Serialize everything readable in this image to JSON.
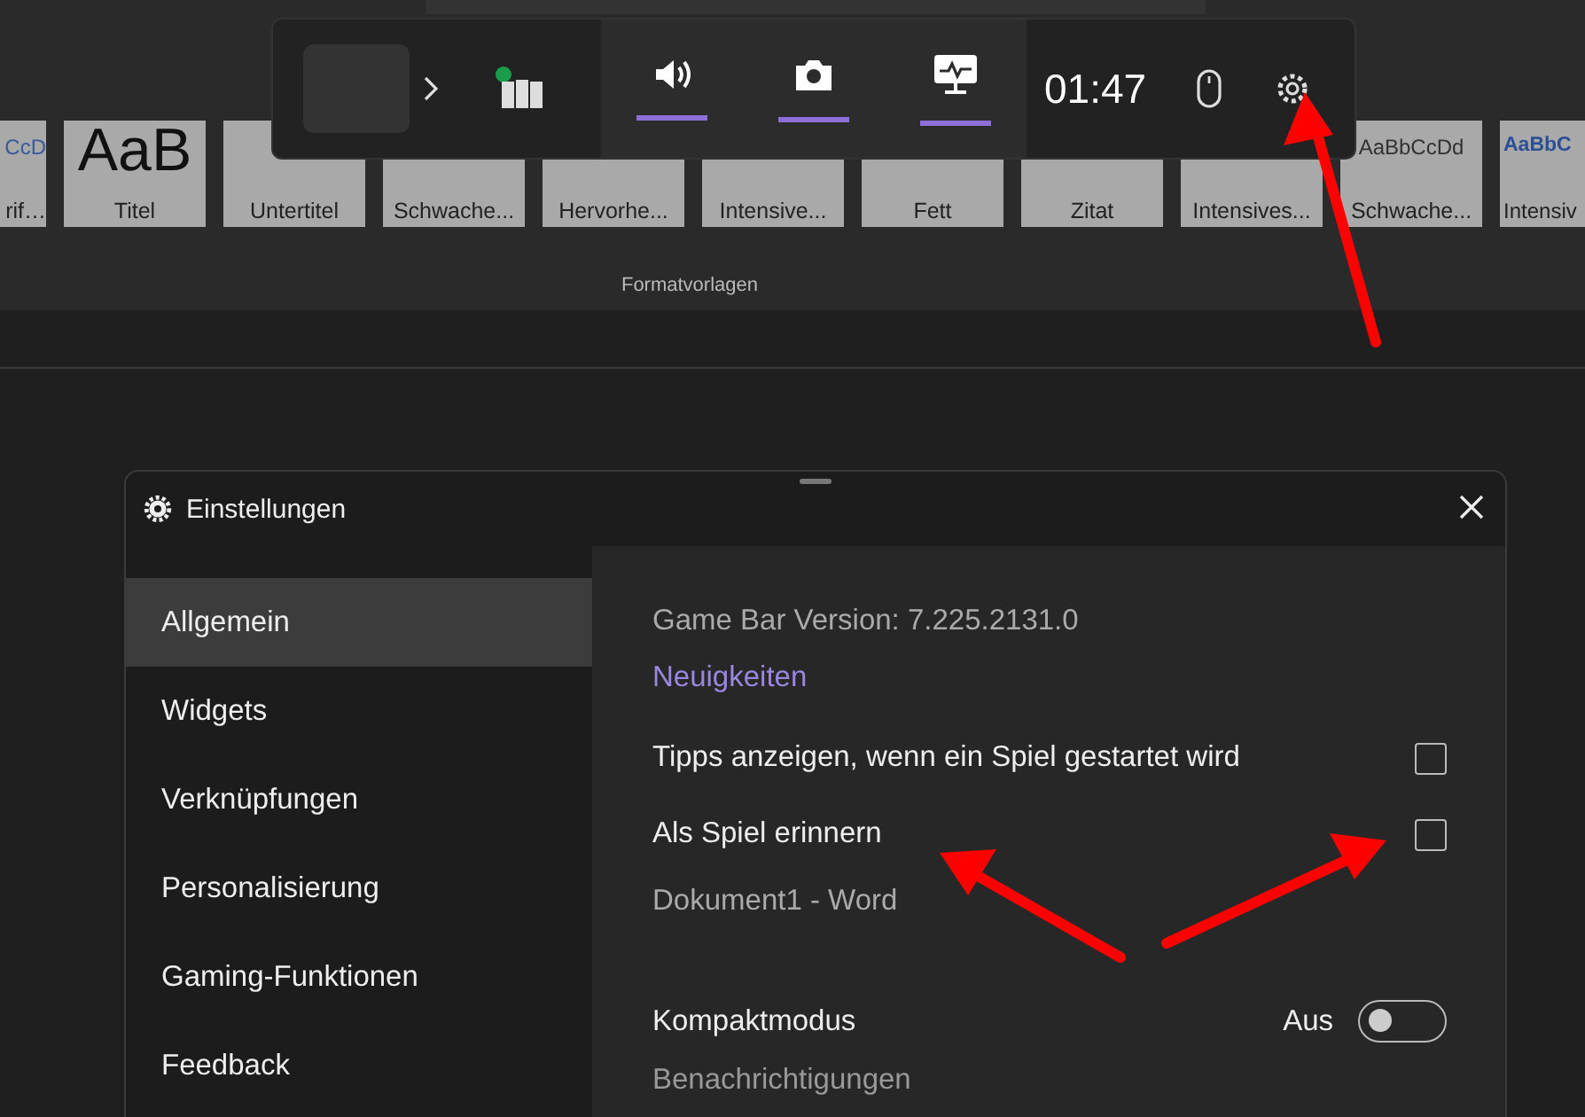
{
  "ribbon": {
    "styles": [
      {
        "sample": "CcD",
        "label": "rif…"
      },
      {
        "sample": "AaB",
        "label": "Titel"
      },
      {
        "label": "Untertitel"
      },
      {
        "label": "Schwache..."
      },
      {
        "label": "Hervorhe..."
      },
      {
        "label": "Intensive..."
      },
      {
        "label": "Fett"
      },
      {
        "label": "Zitat"
      },
      {
        "label": "Intensives..."
      },
      {
        "sample": "AaBbCcDd",
        "label": "Schwache..."
      },
      {
        "sample": "AaBbC",
        "label": "Intensiv"
      }
    ],
    "group_label": "Formatvorlagen"
  },
  "game_bar": {
    "widgets": [
      {
        "kind": "audio",
        "active": true
      },
      {
        "kind": "capture",
        "active": true
      },
      {
        "kind": "performance",
        "active": true
      }
    ],
    "time": "01:47"
  },
  "settings": {
    "title": "Einstellungen",
    "nav": [
      {
        "label": "Allgemein",
        "selected": true
      },
      {
        "label": "Widgets",
        "selected": false
      },
      {
        "label": "Verknüpfungen",
        "selected": false
      },
      {
        "label": "Personalisierung",
        "selected": false
      },
      {
        "label": "Gaming-Funktionen",
        "selected": false
      },
      {
        "label": "Feedback",
        "selected": false
      }
    ],
    "content": [
      {
        "kind": "info",
        "text": "Game Bar Version: 7.225.2131.0"
      },
      {
        "kind": "link",
        "text": "Neuigkeiten"
      },
      {
        "kind": "checkbox",
        "text": "Tipps anzeigen, wenn ein Spiel gestartet wird",
        "checked": false
      },
      {
        "kind": "checkbox",
        "text": "Als Spiel erinnern",
        "checked": false
      },
      {
        "kind": "info",
        "text": "Dokument1 - Word"
      },
      {
        "kind": "toggle",
        "text": "Kompaktmodus",
        "state_label": "Aus",
        "on": false
      },
      {
        "kind": "heading",
        "text": "Benachrichtigungen"
      }
    ]
  }
}
